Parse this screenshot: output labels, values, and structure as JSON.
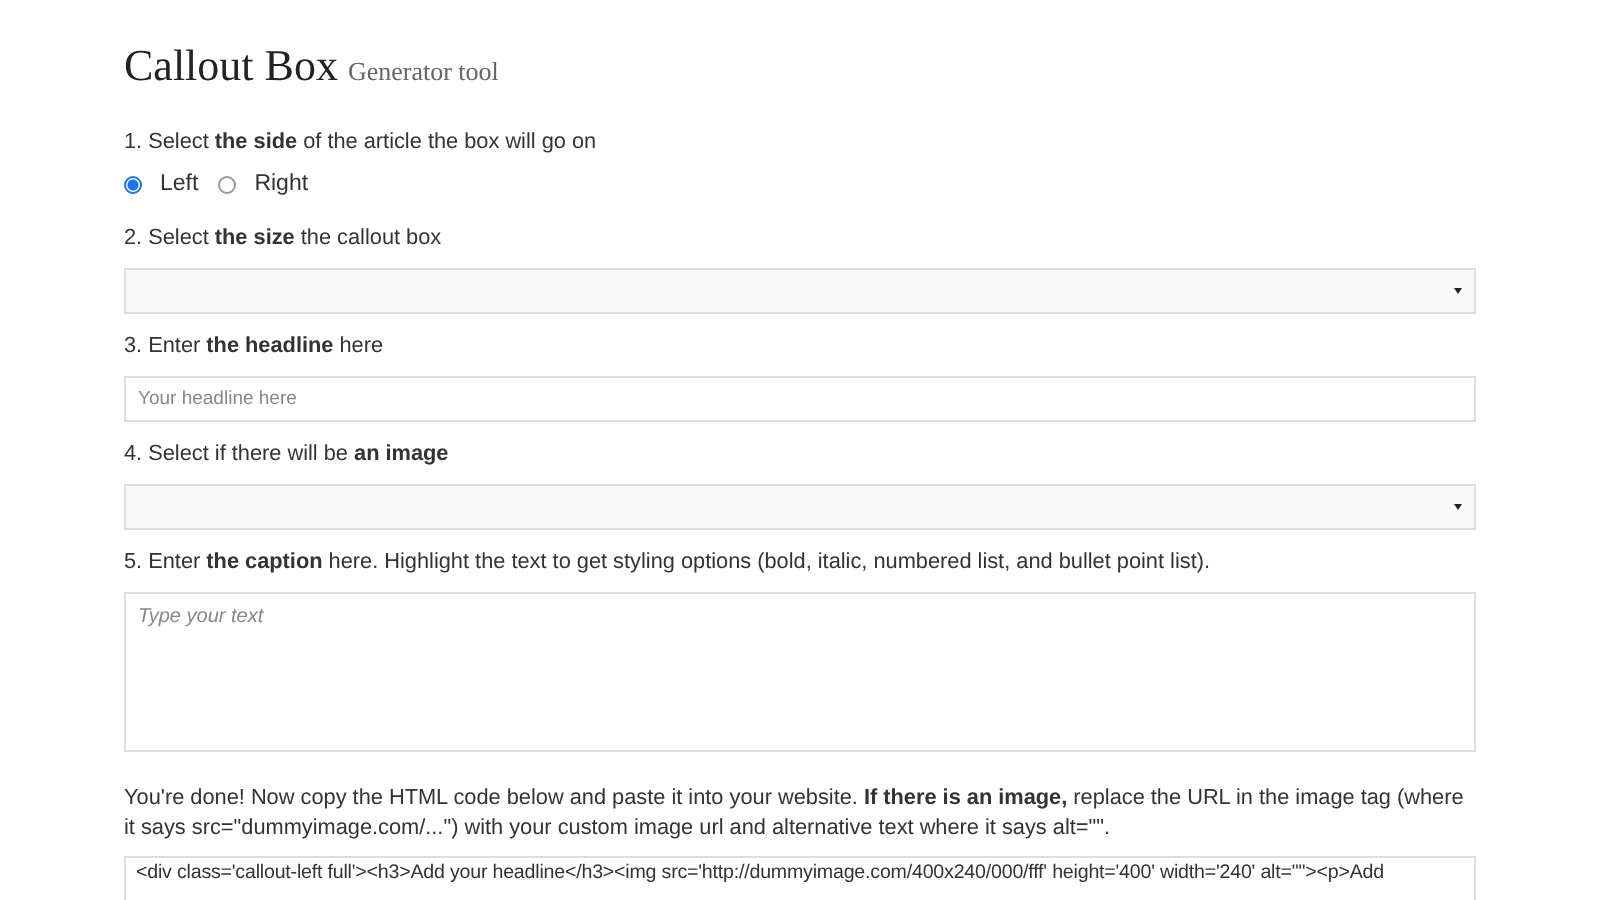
{
  "title": "Callout Box",
  "subtitle": "Generator tool",
  "steps": [
    {
      "kind": "radio",
      "label": "1. Select **the side** of the article the box will go on",
      "options": [
        {
          "label": "Left",
          "selected": true
        },
        {
          "label": "Right",
          "selected": false
        }
      ]
    },
    {
      "kind": "select",
      "label": "2. Select **the size** the callout box"
    },
    {
      "kind": "input",
      "label": "3. Enter **the headline** here",
      "placeholder": "Your headline here"
    },
    {
      "kind": "select",
      "label": "4. Select if there will be **an image**"
    },
    {
      "kind": "textarea",
      "label": "5. Enter **the caption** here. Highlight the text to get styling options (bold, italic, numbered list, and bullet point list).",
      "placeholder": "Type your text"
    }
  ],
  "instructions": "You're done! Now copy the HTML code below and paste it into your website. **If there is an image,** replace the URL in the image tag (where it says src=\"dummyimage.com/...\") with your custom image url and alternative text where it says alt=\"\".",
  "code_output": "<div class='callout-left full'><h3>Add your headline</h3><img src='http://dummyimage.com/400x240/000/fff' height='400' width='240' alt=\"\"><p>Add"
}
